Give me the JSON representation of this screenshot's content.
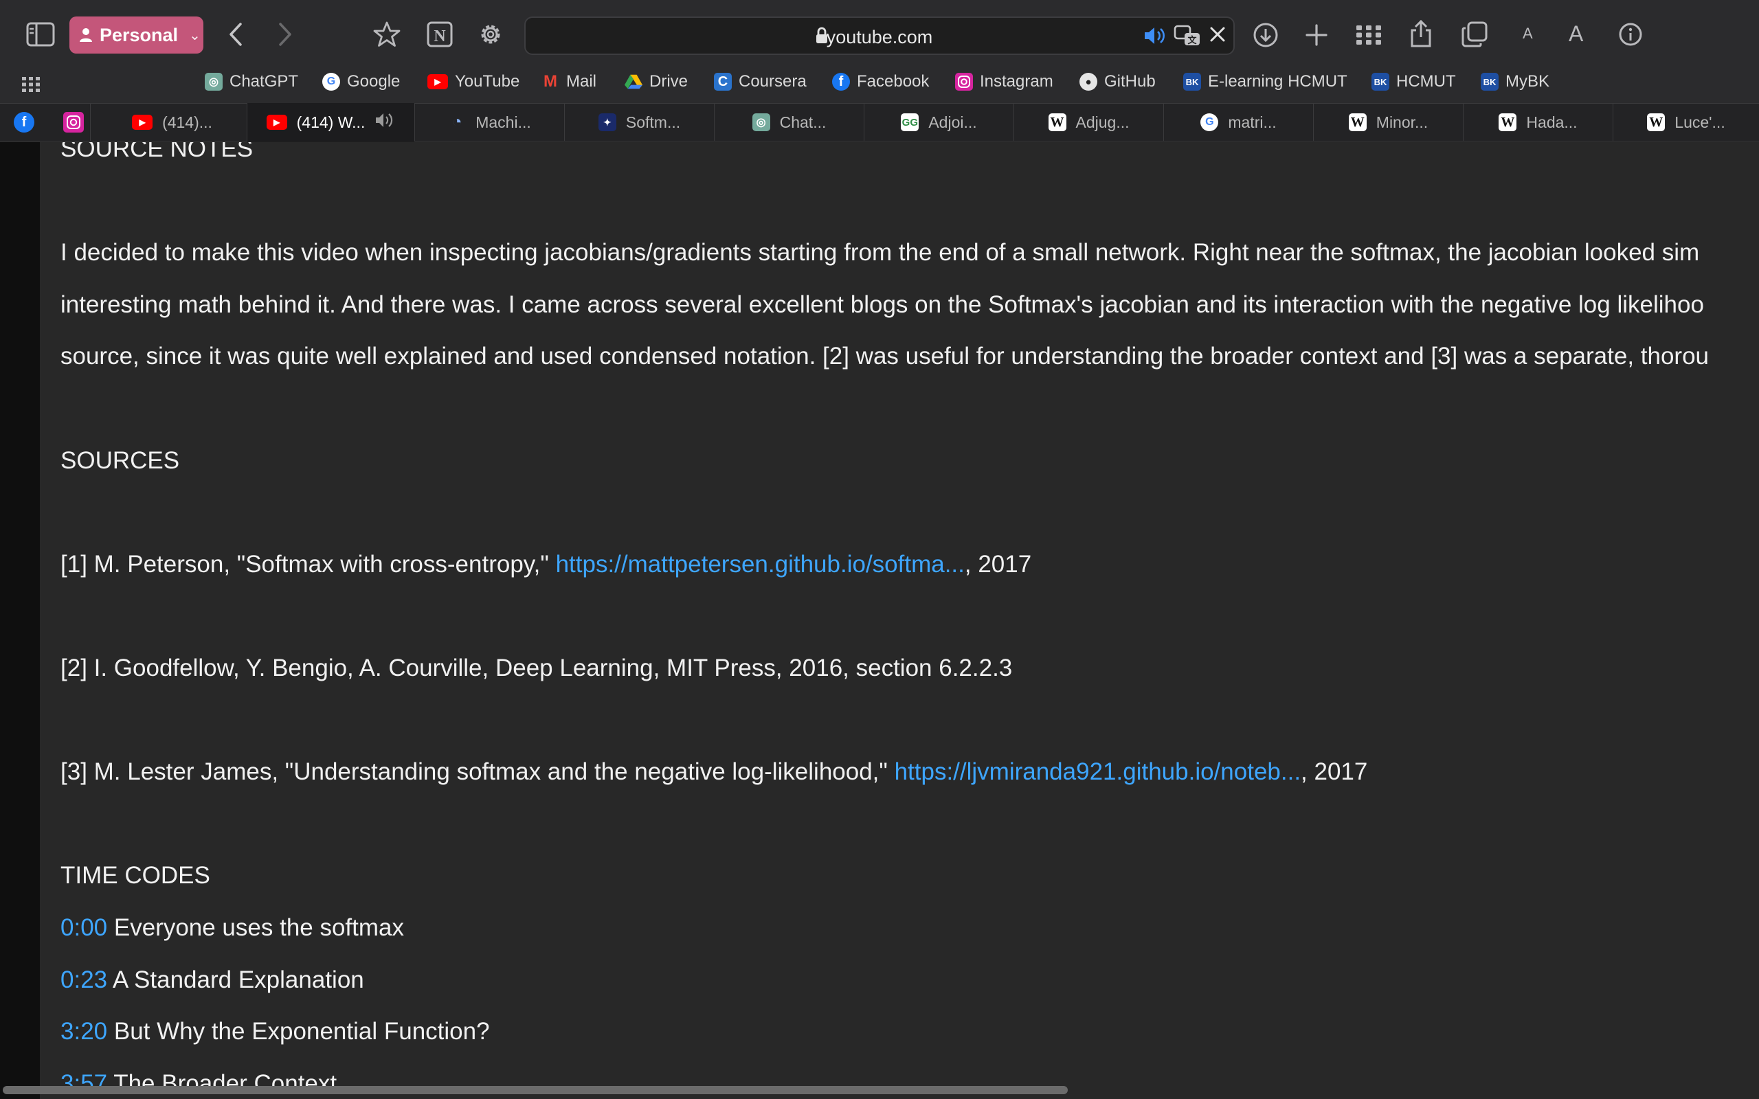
{
  "toolbar": {
    "profile_label": "Personal",
    "url": "youtube.com",
    "font_small": "A",
    "font_large": "A"
  },
  "bookmarks": [
    {
      "label": "ChatGPT",
      "icon": "chatgpt-icon"
    },
    {
      "label": "Google",
      "icon": "google-icon"
    },
    {
      "label": "YouTube",
      "icon": "youtube-icon"
    },
    {
      "label": "Mail",
      "icon": "gmail-icon"
    },
    {
      "label": "Drive",
      "icon": "drive-icon"
    },
    {
      "label": "Coursera",
      "icon": "coursera-icon"
    },
    {
      "label": "Facebook",
      "icon": "facebook-icon"
    },
    {
      "label": "Instagram",
      "icon": "instagram-icon"
    },
    {
      "label": "GitHub",
      "icon": "github-icon"
    },
    {
      "label": "E-learning HCMUT",
      "icon": "hcmut-icon"
    },
    {
      "label": "HCMUT",
      "icon": "hcmut-icon"
    },
    {
      "label": "MyBK",
      "icon": "hcmut-icon"
    }
  ],
  "tabs": [
    {
      "label": "(414)...",
      "icon": "youtube-icon"
    },
    {
      "label": "(414) W...",
      "icon": "youtube-icon",
      "active": true
    },
    {
      "label": "Machi...",
      "icon": "ml-icon"
    },
    {
      "label": "Softm...",
      "icon": "video-thumb-icon"
    },
    {
      "label": "Chat...",
      "icon": "chatgpt-icon"
    },
    {
      "label": "Adjoi...",
      "icon": "geeksforgeeks-icon"
    },
    {
      "label": "Adjug...",
      "icon": "wikipedia-icon"
    },
    {
      "label": "matri...",
      "icon": "google-icon"
    },
    {
      "label": "Minor...",
      "icon": "wikipedia-icon"
    },
    {
      "label": "Hada...",
      "icon": "wikipedia-icon"
    },
    {
      "label": "Luce'...",
      "icon": "wikipedia-icon"
    }
  ],
  "description": {
    "source_notes_heading": "SOURCE NOTES",
    "notes_line1": "I decided to make this video when inspecting jacobians/gradients starting from the end of a small network. Right near the softmax, the jacobian looked sim",
    "notes_line2": "interesting math behind it. And there was. I came across several excellent blogs on the Softmax's jacobian and its interaction with the negative log likelihoo",
    "notes_line3": "source, since it was quite well explained and used condensed notation. [2] was useful for understanding the broader context and [3] was a separate, thorou",
    "sources_heading": "SOURCES",
    "source1_text": "[1] M. Peterson, \"Softmax with cross-entropy,\" ",
    "source1_link": "https://mattpetersen.github.io/softma...",
    "source1_suffix": ", 2017",
    "source2_text": "[2] I. Goodfellow, Y. Bengio, A. Courville, Deep Learning, MIT Press, 2016, section 6.2.2.3",
    "source3_text": "[3] M. Lester James, \"Understanding softmax and the negative log-likelihood,\" ",
    "source3_link": "https://ljvmiranda921.github.io/noteb...",
    "source3_suffix": ", 2017",
    "timecodes_heading": "TIME CODES",
    "timecodes": [
      {
        "time": "0:00",
        "title": " Everyone uses the softmax"
      },
      {
        "time": "0:23",
        "title": " A Standard Explanation"
      },
      {
        "time": "3:20",
        "title": " But Why the Exponential Function?"
      },
      {
        "time": "3:57",
        "title": " The Broader Context"
      }
    ]
  },
  "colors": {
    "profile": "#c4567a",
    "link": "#3ea6ff",
    "speaker_active": "#3e8ef7"
  }
}
